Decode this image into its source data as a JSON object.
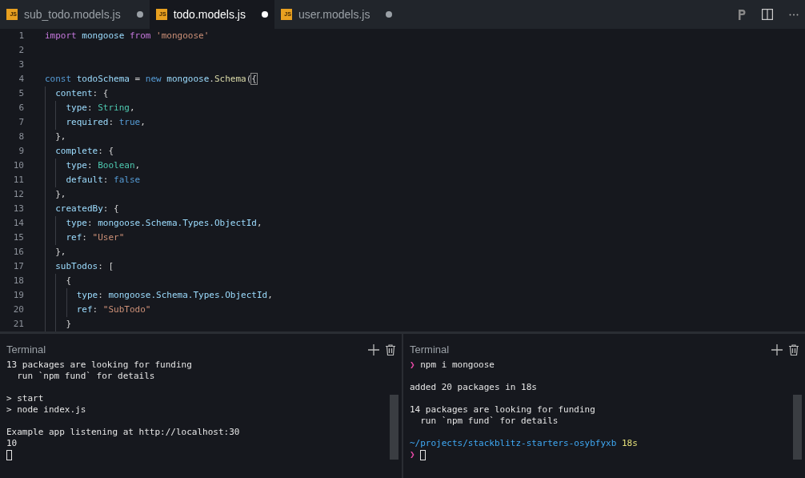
{
  "tabs": [
    {
      "icon_label": "JS",
      "label": "sub_todo.models.js",
      "selected": false,
      "modified": true
    },
    {
      "icon_label": "JS",
      "label": "todo.models.js",
      "selected": true,
      "modified": true
    },
    {
      "icon_label": "JS",
      "label": "user.models.js",
      "selected": false,
      "modified": true
    }
  ],
  "editor": {
    "lines": [
      {
        "number": "1",
        "tokens": [
          {
            "kind": "kw",
            "text": "import"
          },
          {
            "kind": "var",
            "text": " mongoose "
          },
          {
            "kind": "kw",
            "text": "from"
          },
          {
            "kind": "str",
            "text": " 'mongoose'"
          }
        ]
      },
      {
        "number": "2"
      },
      {
        "number": "3"
      },
      {
        "number": "4",
        "tokens": [
          {
            "kind": "decl",
            "text": "const"
          },
          {
            "kind": "var",
            "text": " todoSchema "
          },
          {
            "kind": "punc",
            "text": "= "
          },
          {
            "kind": "decl",
            "text": "new"
          },
          {
            "kind": "var",
            "text": " mongoose"
          },
          {
            "kind": "punc",
            "text": "."
          },
          {
            "kind": "fn",
            "text": "Schema"
          },
          {
            "kind": "punc",
            "text": "("
          },
          {
            "kind": "bracket",
            "text": "{"
          }
        ]
      },
      {
        "number": "5",
        "tokens": [
          {
            "kind": "var",
            "text": "  content"
          },
          {
            "kind": "punc",
            "text": ": {"
          }
        ]
      },
      {
        "number": "6",
        "tokens": [
          {
            "kind": "var",
            "text": "    type"
          },
          {
            "kind": "punc",
            "text": ": "
          },
          {
            "kind": "cls",
            "text": "String"
          },
          {
            "kind": "punc",
            "text": ","
          }
        ]
      },
      {
        "number": "7",
        "tokens": [
          {
            "kind": "var",
            "text": "    required"
          },
          {
            "kind": "punc",
            "text": ": "
          },
          {
            "kind": "decl",
            "text": "true"
          },
          {
            "kind": "punc",
            "text": ","
          }
        ]
      },
      {
        "number": "8",
        "tokens": [
          {
            "kind": "punc",
            "text": "  },"
          }
        ]
      },
      {
        "number": "9",
        "tokens": [
          {
            "kind": "var",
            "text": "  complete"
          },
          {
            "kind": "punc",
            "text": ": {"
          }
        ]
      },
      {
        "number": "10",
        "tokens": [
          {
            "kind": "var",
            "text": "    type"
          },
          {
            "kind": "punc",
            "text": ": "
          },
          {
            "kind": "cls",
            "text": "Boolean"
          },
          {
            "kind": "punc",
            "text": ","
          }
        ]
      },
      {
        "number": "11",
        "tokens": [
          {
            "kind": "var",
            "text": "    default"
          },
          {
            "kind": "punc",
            "text": ": "
          },
          {
            "kind": "decl",
            "text": "false"
          }
        ]
      },
      {
        "number": "12",
        "tokens": [
          {
            "kind": "punc",
            "text": "  },"
          }
        ]
      },
      {
        "number": "13",
        "tokens": [
          {
            "kind": "var",
            "text": "  createdBy"
          },
          {
            "kind": "punc",
            "text": ": {"
          }
        ]
      },
      {
        "number": "14",
        "tokens": [
          {
            "kind": "var",
            "text": "    type"
          },
          {
            "kind": "punc",
            "text": ": "
          },
          {
            "kind": "var",
            "text": "mongoose.Schema.Types.ObjectId"
          },
          {
            "kind": "punc",
            "text": ","
          }
        ]
      },
      {
        "number": "15",
        "tokens": [
          {
            "kind": "var",
            "text": "    ref"
          },
          {
            "kind": "punc",
            "text": ": "
          },
          {
            "kind": "str",
            "text": "\"User\""
          }
        ]
      },
      {
        "number": "16",
        "tokens": [
          {
            "kind": "punc",
            "text": "  },"
          }
        ]
      },
      {
        "number": "17",
        "tokens": [
          {
            "kind": "var",
            "text": "  subTodos"
          },
          {
            "kind": "punc",
            "text": ": ["
          }
        ]
      },
      {
        "number": "18",
        "tokens": [
          {
            "kind": "punc",
            "text": "    {"
          }
        ]
      },
      {
        "number": "19",
        "tokens": [
          {
            "kind": "var",
            "text": "      type"
          },
          {
            "kind": "punc",
            "text": ": "
          },
          {
            "kind": "var",
            "text": "mongoose.Schema.Types.ObjectId"
          },
          {
            "kind": "punc",
            "text": ","
          }
        ]
      },
      {
        "number": "20",
        "tokens": [
          {
            "kind": "var",
            "text": "      ref"
          },
          {
            "kind": "punc",
            "text": ": "
          },
          {
            "kind": "str",
            "text": "\"SubTodo\""
          }
        ]
      },
      {
        "number": "21",
        "tokens": [
          {
            "kind": "punc",
            "text": "    }"
          }
        ]
      }
    ]
  },
  "terminals": [
    {
      "title": "Terminal",
      "lines": [
        {
          "kind": "text",
          "segments": [
            {
              "kind": "plain",
              "text": "13 packages are looking for funding"
            }
          ]
        },
        {
          "kind": "text",
          "segments": [
            {
              "kind": "plain",
              "text": "  run `npm fund` for details"
            }
          ]
        },
        {
          "kind": "blank"
        },
        {
          "kind": "text",
          "segments": [
            {
              "kind": "plain",
              "text": "> start"
            }
          ]
        },
        {
          "kind": "text",
          "segments": [
            {
              "kind": "plain",
              "text": "> node index.js"
            }
          ]
        },
        {
          "kind": "blank"
        },
        {
          "kind": "text",
          "segments": [
            {
              "kind": "plain",
              "text": "Example app listening at http://localhost:30"
            }
          ]
        },
        {
          "kind": "text",
          "segments": [
            {
              "kind": "plain",
              "text": "10"
            }
          ]
        },
        {
          "kind": "text",
          "segments": [
            {
              "kind": "cursor"
            }
          ]
        }
      ]
    },
    {
      "title": "Terminal",
      "lines": [
        {
          "kind": "text",
          "segments": [
            {
              "kind": "prompt",
              "text": "❯"
            },
            {
              "kind": "plain",
              "text": " npm i mongoose"
            }
          ]
        },
        {
          "kind": "blank"
        },
        {
          "kind": "text",
          "segments": [
            {
              "kind": "plain",
              "text": "added 20 packages in 18s"
            }
          ]
        },
        {
          "kind": "blank"
        },
        {
          "kind": "text",
          "segments": [
            {
              "kind": "plain",
              "text": "14 packages are looking for funding"
            }
          ]
        },
        {
          "kind": "text",
          "segments": [
            {
              "kind": "plain",
              "text": "  run `npm fund` for details"
            }
          ]
        },
        {
          "kind": "blank"
        },
        {
          "kind": "text",
          "segments": [
            {
              "kind": "path",
              "text": "~/projects/stackblitz-starters-osybfyxb"
            },
            {
              "kind": "time",
              "text": " 18s"
            }
          ]
        },
        {
          "kind": "text",
          "segments": [
            {
              "kind": "prompt",
              "text": "❯"
            },
            {
              "kind": "cursor"
            }
          ]
        }
      ]
    }
  ]
}
